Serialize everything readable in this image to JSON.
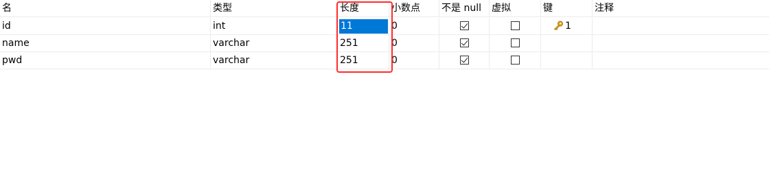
{
  "columns": {
    "name": "名",
    "type": "类型",
    "length": "长度",
    "decimals": "小数点",
    "not_null": "不是 null",
    "virtual": "虚拟",
    "key": "键",
    "comment": "注释"
  },
  "rows": [
    {
      "name": "id",
      "type": "int",
      "length": "11",
      "decimals": "0",
      "not_null": true,
      "virtual": false,
      "key": "1",
      "comment": ""
    },
    {
      "name": "name",
      "type": "varchar",
      "length": "251",
      "decimals": "0",
      "not_null": true,
      "virtual": false,
      "key": "",
      "comment": ""
    },
    {
      "name": "pwd",
      "type": "varchar",
      "length": "251",
      "decimals": "0",
      "not_null": true,
      "virtual": false,
      "key": "",
      "comment": ""
    }
  ],
  "icons": {
    "key": "key-icon",
    "checkbox": "checkbox"
  },
  "colors": {
    "selection": "#0078d7",
    "highlight_box": "#ff2a2a",
    "key_icon": "#d4a017"
  }
}
